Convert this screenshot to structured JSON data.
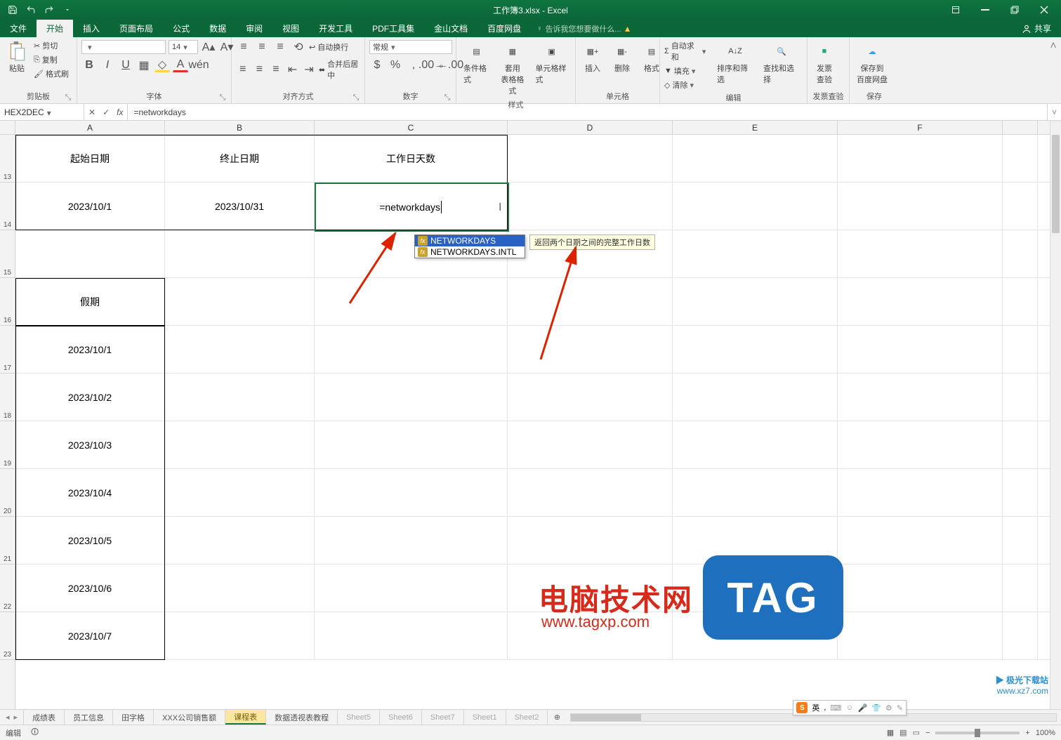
{
  "title": "工作簿3.xlsx - Excel",
  "menutabs": {
    "file": "文件",
    "home": "开始",
    "insert": "插入",
    "layout": "页面布局",
    "formulas": "公式",
    "data": "数据",
    "review": "审阅",
    "view": "视图",
    "dev": "开发工具",
    "pdf": "PDF工具集",
    "wps": "金山文档",
    "baidu": "百度网盘",
    "tell": "告诉我您想要做什么...",
    "share": "共享"
  },
  "ribbon": {
    "clipboard": {
      "paste": "粘贴",
      "cut": "剪切",
      "copy": "复制",
      "fmt": "格式刷",
      "label": "剪贴板"
    },
    "font": {
      "name": "",
      "size": "14",
      "label": "字体"
    },
    "align": {
      "wrap": "自动换行",
      "merge": "合并后居中",
      "label": "对齐方式"
    },
    "number": {
      "fmt": "常规",
      "label": "数字"
    },
    "styles": {
      "cond": "条件格式",
      "tbl": "套用\n表格格式",
      "cell": "单元格样式",
      "label": "样式"
    },
    "cells": {
      "ins": "插入",
      "del": "删除",
      "fmt": "格式",
      "label": "单元格"
    },
    "editing": {
      "sum": "自动求和",
      "fill": "填充",
      "clear": "清除",
      "sort": "排序和筛选",
      "find": "查找和选择",
      "label": "编辑"
    },
    "invoice": {
      "chk": "发票\n查验",
      "label": "发票查验"
    },
    "save": {
      "baidu": "保存到\n百度网盘",
      "label": "保存"
    }
  },
  "fbar": {
    "name": "HEX2DEC",
    "formula": "=networkdays"
  },
  "columns": [
    "A",
    "B",
    "C",
    "D",
    "E",
    "F"
  ],
  "rownums": [
    "13",
    "14",
    "15",
    "16",
    "17",
    "18",
    "19",
    "20",
    "21",
    "22",
    "23"
  ],
  "cells": {
    "h1": "起始日期",
    "h2": "终止日期",
    "h3": "工作日天数",
    "r2a": "2023/10/1",
    "r2b": "2023/10/31",
    "r2c": "=networkdays",
    "r4a": "假期",
    "d1": "2023/10/1",
    "d2": "2023/10/2",
    "d3": "2023/10/3",
    "d4": "2023/10/4",
    "d5": "2023/10/5",
    "d6": "2023/10/6",
    "d7": "2023/10/7"
  },
  "suggest": {
    "a": "NETWORKDAYS",
    "b": "NETWORKDAYS.INTL"
  },
  "tooltip": "返回两个日期之间的完整工作日数",
  "sheets": {
    "s1": "成绩表",
    "s2": "员工信息",
    "s3": "田字格",
    "s4": "XXX公司销售额",
    "s5": "课程表",
    "s6": "数据透视表教程",
    "s7": "Sheet5",
    "s8": "Sheet6",
    "s9": "Sheet7",
    "s10": "Sheet1",
    "s11": "Sheet2"
  },
  "status": {
    "mode": "编辑",
    "acc": "",
    "zoom": "100%"
  },
  "ime": {
    "lang": "英",
    "sep": ","
  },
  "wm": {
    "brand": "电脑技术网",
    "url": "www.tagxp.com",
    "tag": "TAG",
    "jg": "▶ 极光下载站",
    "jgurl": "www.xz7.com"
  }
}
